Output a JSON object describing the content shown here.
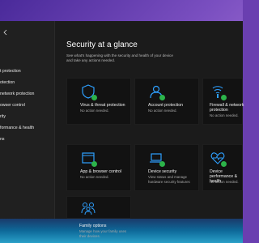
{
  "sidebar": {
    "items": [
      {
        "label": "t protection"
      },
      {
        "label": "otection"
      },
      {
        "label": "network protection"
      },
      {
        "label": "owser control"
      },
      {
        "label": "rity"
      },
      {
        "label": "formance & health"
      },
      {
        "label": "ns"
      }
    ]
  },
  "main": {
    "title": "Security at a glance",
    "subtitle": "See what's happening with the security and health of your device and take any actions needed.",
    "tiles": [
      {
        "title": "Virus & threat protection",
        "status": "No action needed.",
        "icon": "shield-icon"
      },
      {
        "title": "Account protection",
        "status": "No action needed.",
        "icon": "person-icon"
      },
      {
        "title": "Firewall & network protection",
        "status": "No action needed.",
        "icon": "wifi-icon"
      },
      {
        "title": "App & browser control",
        "status": "No action needed.",
        "icon": "browser-icon"
      },
      {
        "title": "Device security",
        "status": "View status and manage hardware security features",
        "icon": "laptop-icon"
      },
      {
        "title": "Device performance & health",
        "status": "No action needed.",
        "icon": "heart-icon"
      },
      {
        "title": "Family options",
        "status": "Manage how your family uses their devices.",
        "icon": "family-icon"
      }
    ]
  },
  "colors": {
    "accent": "#2ea0ff",
    "check": "#2cb34a",
    "background": "#1b1b1b"
  }
}
